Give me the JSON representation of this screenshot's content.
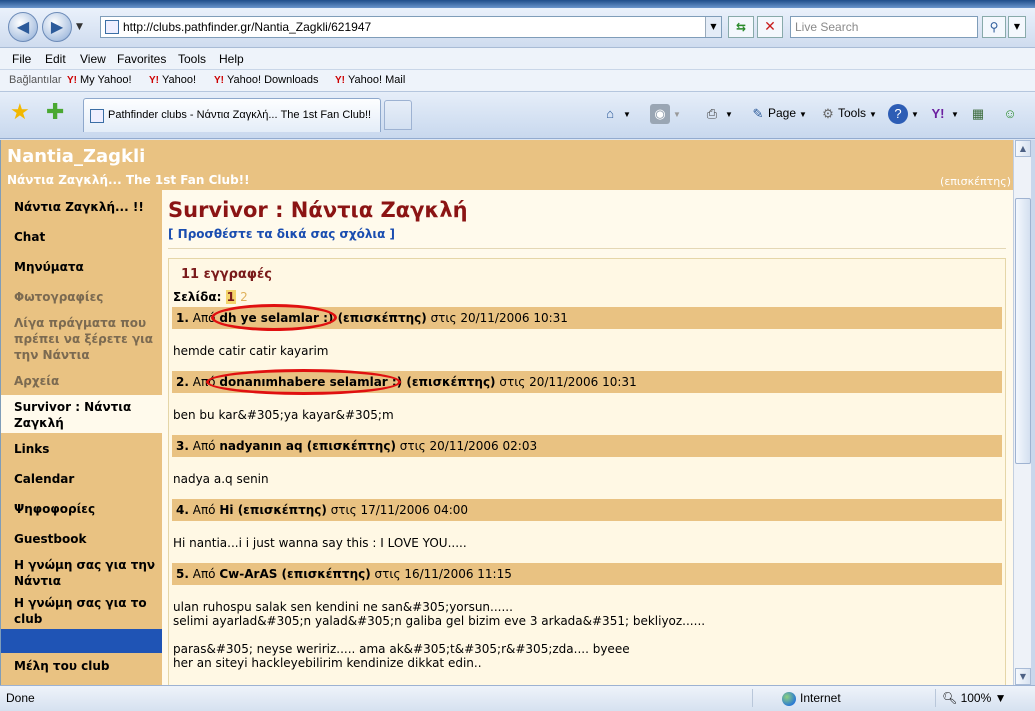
{
  "browser": {
    "url": "http://clubs.pathfinder.gr/Nantia_Zagkli/621947",
    "search_placeholder": "Live Search",
    "menu": [
      "File",
      "Edit",
      "View",
      "Favorites",
      "Tools",
      "Help"
    ],
    "links_label": "Bağlantılar",
    "links": [
      "My Yahoo!",
      "Yahoo!",
      "Yahoo! Downloads",
      "Yahoo! Mail"
    ],
    "tab_title": "Pathfinder clubs - Νάντια Ζαγκλή... The 1st Fan Club!!",
    "commands": {
      "page": "Page",
      "tools": "Tools"
    },
    "status": "Done",
    "zone": "Internet",
    "zoom": "100%"
  },
  "site": {
    "title": "Nantia_Zagkli",
    "subtitle": "Νάντια Ζαγκλή... The 1st Fan Club!!",
    "user": "(επισκέπτης)"
  },
  "sidebar": {
    "items": [
      {
        "label": "Νάντια Ζαγκλή... !!"
      },
      {
        "label": "Chat"
      },
      {
        "label": "Μηνύματα"
      },
      {
        "label": "Φωτογραφίες"
      },
      {
        "label": "Λίγα πράγματα που πρέπει να ξέρετε για την Νάντια"
      },
      {
        "label": "Αρχεία"
      },
      {
        "label": "Survivor : Νάντια Ζαγκλή"
      },
      {
        "label": "Links"
      },
      {
        "label": "Calendar"
      },
      {
        "label": "Ψηφοφορίες"
      },
      {
        "label": "Guestbook"
      },
      {
        "label": "Η γνώμη σας για την Νάντια"
      },
      {
        "label": "Η γνώμη σας για το club"
      },
      {
        "label": "Μέλη του club"
      }
    ]
  },
  "main": {
    "heading": "Survivor : Νάντια Ζαγκλή",
    "add_comments": "[ Προσθέστε τα δικά σας σχόλια ]",
    "entries_count": "11 εγγραφές",
    "pager_label": "Σελίδα:",
    "pager_current": "1",
    "pager_next": "2",
    "from_word": "Από",
    "at_word": "στις",
    "entries": [
      {
        "num": "1.",
        "author": "dh ye selamlar :) (επισκέπτης)",
        "date": "20/11/2006 10:31",
        "body": "hemde catir catir kayarim"
      },
      {
        "num": "2.",
        "author": "donanımhabere selamlar :) (επισκέπτης)",
        "date": "20/11/2006 10:31",
        "body": "ben bu kar&#305;ya kayar&#305;m"
      },
      {
        "num": "3.",
        "author": "nadyanın aq (επισκέπτης)",
        "date": "20/11/2006 02:03",
        "body": "nadya a.q senin"
      },
      {
        "num": "4.",
        "author": "Hi (επισκέπτης)",
        "date": "17/11/2006 04:00",
        "body": "Hi nantia...i i just wanna say this : I LOVE YOU....."
      },
      {
        "num": "5.",
        "author": "Cw-ArAS (επισκέπτης)",
        "date": "16/11/2006 11:15",
        "body": "ulan ruhospu salak sen kendini ne san&#305;yorsun......\nselimi ayarlad&#305;n yalad&#305;n galiba gel bizim eve 3 arkada&#351; bekliyoz......\n\nparas&#305; neyse weririz..... ama ak&#305;t&#305;r&#305;zda.... byeee\nher an siteyi hackleyebilirim kendinize dikkat edin.."
      }
    ]
  },
  "colors": {
    "sidebar_bg": "#e9c282",
    "content_bg": "#fffaec",
    "heading": "#8b1414",
    "link_blue": "#1a4db0",
    "highlight_red": "#e01010"
  }
}
